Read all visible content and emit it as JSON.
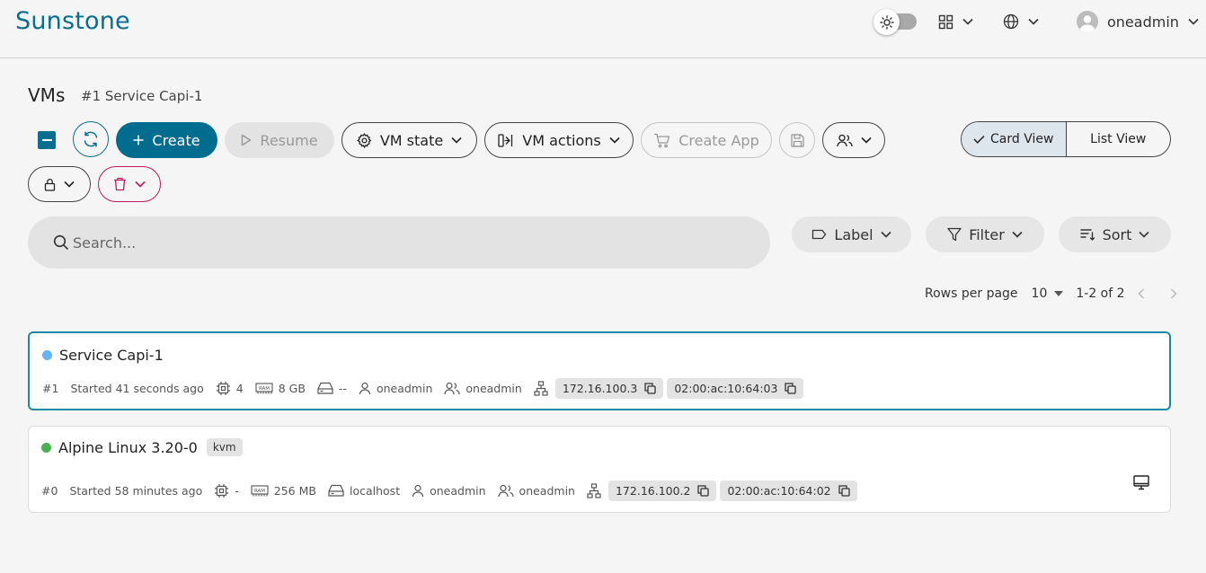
{
  "header": {
    "brand": "Sunstone",
    "user": "oneadmin"
  },
  "page": {
    "title": "VMs",
    "subtitle": "#1 Service Capi-1"
  },
  "toolbar": {
    "create": "Create",
    "resume": "Resume",
    "vm_state": "VM state",
    "vm_actions": "VM actions",
    "create_app": "Create App",
    "card_view": "Card View",
    "list_view": "List View"
  },
  "search": {
    "placeholder": "Search..."
  },
  "filters": {
    "label": "Label",
    "filter": "Filter",
    "sort": "Sort"
  },
  "pagination": {
    "rows_label": "Rows per page",
    "rows_value": "10",
    "range": "1-2 of 2"
  },
  "vms": [
    {
      "name": "Service Capi-1",
      "status_color": "#64b5f6",
      "id": "#1",
      "started": "Started 41 seconds ago",
      "cpu": "4",
      "memory": "8 GB",
      "host": "--",
      "owner": "oneadmin",
      "group": "oneadmin",
      "ip": "172.16.100.3",
      "mac": "02:00:ac:10:64:03"
    },
    {
      "name": "Alpine Linux 3.20-0",
      "tag": "kvm",
      "status_color": "#4caf50",
      "id": "#0",
      "started": "Started 58 minutes ago",
      "cpu": "-",
      "memory": "256 MB",
      "host": "localhost",
      "owner": "oneadmin",
      "group": "oneadmin",
      "ip": "172.16.100.2",
      "mac": "02:00:ac:10:64:02"
    }
  ],
  "colors": {
    "brand": "#0a6e8e",
    "primary": "#006d8f",
    "running": "#4caf50",
    "pending": "#64b5f6",
    "danger": "#c2185b"
  }
}
